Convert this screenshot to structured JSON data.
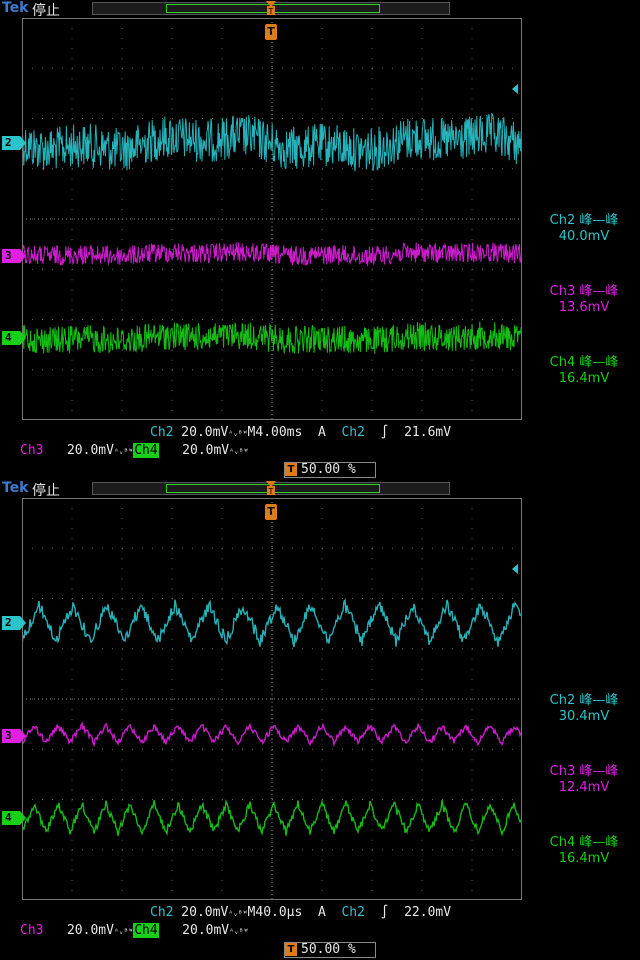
{
  "colors": {
    "ch2": "#2bc4cc",
    "ch3": "#e020e0",
    "ch4": "#18d018",
    "trigger": "#e07b1a",
    "record_window": "#2ecc2e"
  },
  "panels": [
    {
      "brand": "Tek",
      "state": "停止",
      "channel_markers": [
        "2",
        "3",
        "4"
      ],
      "measurements": [
        {
          "label": "Ch2 峰—峰",
          "value": "40.0mV"
        },
        {
          "label": "Ch3 峰—峰",
          "value": "13.6mV"
        },
        {
          "label": "Ch4 峰—峰",
          "value": "16.4mV"
        }
      ],
      "row1": {
        "ch2": "Ch2",
        "ch2_scale": " 20.0mV",
        "bw": "ᴬᵥᴮᵂ",
        "timebase": "M4.00ms",
        "acq": "A",
        "trig_src": "Ch2",
        "slope": "∫",
        "trig_level": "21.6mV"
      },
      "row2": {
        "ch3": "Ch3",
        "ch3_scale": " 20.0mV",
        "bw": "ᴬᵥᴮᵂ",
        "ch4": "Ch4",
        "ch4_scale": " 20.0mV"
      },
      "trigger_position": "50.00 %",
      "trace_mode": "noise"
    },
    {
      "brand": "Tek",
      "state": "停止",
      "channel_markers": [
        "2",
        "3",
        "4"
      ],
      "measurements": [
        {
          "label": "Ch2 峰—峰",
          "value": "30.4mV"
        },
        {
          "label": "Ch3 峰—峰",
          "value": "12.4mV"
        },
        {
          "label": "Ch4 峰—峰",
          "value": "16.4mV"
        }
      ],
      "row1": {
        "ch2": "Ch2",
        "ch2_scale": " 20.0mV",
        "bw": "ᴬᵥᴮᵂ",
        "timebase": "M40.0µs",
        "acq": "A",
        "trig_src": "Ch2",
        "slope": "∫",
        "trig_level": "22.0mV"
      },
      "row2": {
        "ch3": "Ch3",
        "ch3_scale": " 20.0mV",
        "bw": "ᴬᵥᴮᵂ",
        "ch4": "Ch4",
        "ch4_scale": " 20.0mV"
      },
      "trigger_position": "50.00 %",
      "trace_mode": "triangle"
    }
  ]
}
